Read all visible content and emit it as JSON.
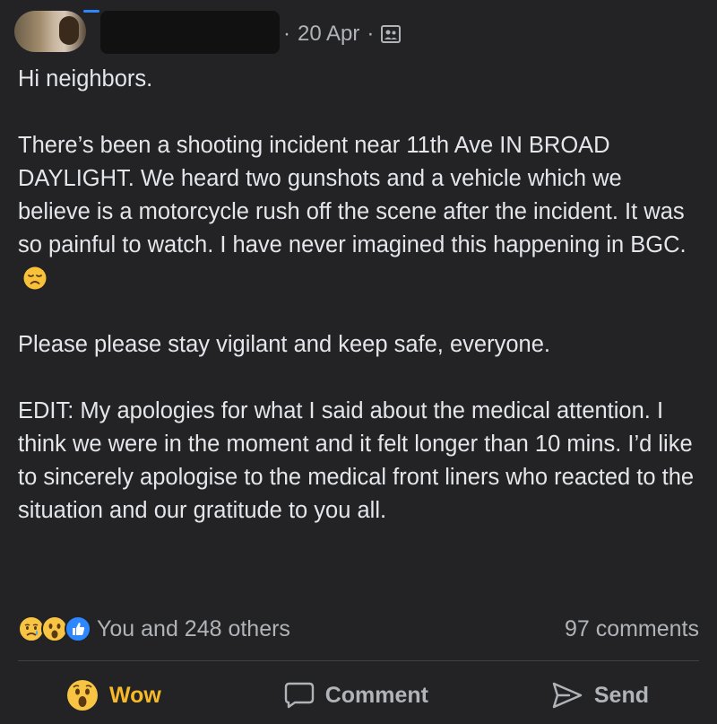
{
  "post": {
    "date": "20 Apr",
    "separator": "·",
    "audience_icon": "group-icon",
    "body": {
      "p1": "Hi neighbors.",
      "p2": "There’s been a shooting incident near 11th Ave IN BROAD DAYLIGHT. We heard two gunshots and a vehicle which we believe is a motorcycle rush off the scene after the incident. It was so painful to watch. I have never imagined this happening in BGC.",
      "p3": "Please please stay vigilant and keep safe, everyone.",
      "p4": "EDIT: My apologies for what I said about the medical attention. I think we were in the moment and it felt longer than 10 mins. I’d like to sincerely apologise to the medical front liners who reacted to the situation and our gratitude to you all."
    }
  },
  "reactions": {
    "icons": [
      "sad-icon",
      "wow-icon",
      "like-icon"
    ],
    "summary": "You and 248 others",
    "comments": "97 comments"
  },
  "actions": {
    "wow_label": "Wow",
    "comment_label": "Comment",
    "send_label": "Send"
  },
  "colors": {
    "background": "#232325",
    "text": "#e4e6eb",
    "muted": "#b0b3b8",
    "wow": "#f7b928",
    "like_blue": "#2d88ff"
  }
}
